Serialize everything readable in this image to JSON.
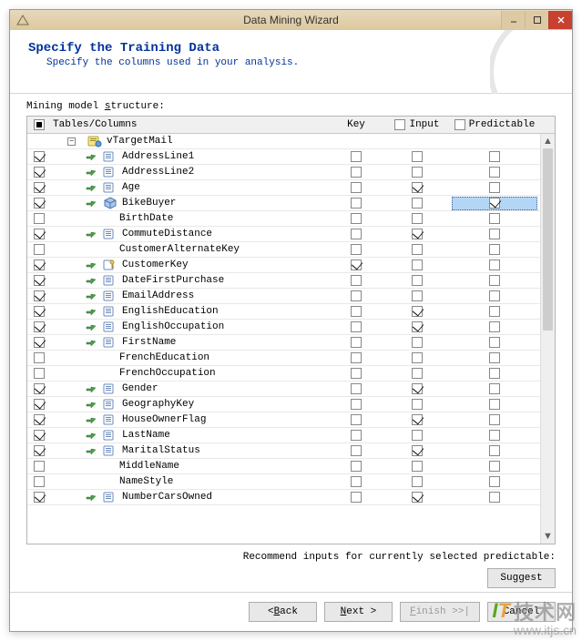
{
  "window": {
    "title": "Data Mining Wizard"
  },
  "header": {
    "title": "Specify the Training Data",
    "subtitle": "Specify the columns used in your analysis."
  },
  "structure_label_pre": "Mining model ",
  "structure_label_u": "s",
  "structure_label_post": "tructure:",
  "table": {
    "head_name": "Tables/Columns",
    "head_key": "Key",
    "head_input": "Input",
    "head_pred": "Predictable",
    "group": "vTargetMail",
    "rows": [
      {
        "sel": true,
        "icons": true,
        "name": "AddressLine1",
        "key": false,
        "in": false,
        "pred": false
      },
      {
        "sel": true,
        "icons": true,
        "name": "AddressLine2",
        "key": false,
        "in": false,
        "pred": false
      },
      {
        "sel": true,
        "icons": true,
        "name": "Age",
        "key": false,
        "in": true,
        "pred": false
      },
      {
        "sel": true,
        "icons": true,
        "name": "BikeBuyer",
        "sel_icon_variant": "cube",
        "key": false,
        "in": false,
        "pred": true,
        "pred_highlight": true
      },
      {
        "sel": false,
        "icons": false,
        "name": "BirthDate",
        "key": false,
        "in": false,
        "pred": false
      },
      {
        "sel": true,
        "icons": true,
        "name": "CommuteDistance",
        "key": false,
        "in": true,
        "pred": false
      },
      {
        "sel": false,
        "icons": false,
        "name": "CustomerAlternateKey",
        "key": false,
        "in": false,
        "pred": false
      },
      {
        "sel": true,
        "icons": true,
        "name": "CustomerKey",
        "sel_icon_variant": "key",
        "key": true,
        "in": false,
        "pred": false
      },
      {
        "sel": true,
        "icons": true,
        "name": "DateFirstPurchase",
        "key": false,
        "in": false,
        "pred": false
      },
      {
        "sel": true,
        "icons": true,
        "name": "EmailAddress",
        "key": false,
        "in": false,
        "pred": false
      },
      {
        "sel": true,
        "icons": true,
        "name": "EnglishEducation",
        "key": false,
        "in": true,
        "pred": false
      },
      {
        "sel": true,
        "icons": true,
        "name": "EnglishOccupation",
        "key": false,
        "in": true,
        "pred": false
      },
      {
        "sel": true,
        "icons": true,
        "name": "FirstName",
        "key": false,
        "in": false,
        "pred": false
      },
      {
        "sel": false,
        "icons": false,
        "name": "FrenchEducation",
        "key": false,
        "in": false,
        "pred": false
      },
      {
        "sel": false,
        "icons": false,
        "name": "FrenchOccupation",
        "key": false,
        "in": false,
        "pred": false
      },
      {
        "sel": true,
        "icons": true,
        "name": "Gender",
        "key": false,
        "in": true,
        "pred": false
      },
      {
        "sel": true,
        "icons": true,
        "name": "GeographyKey",
        "key": false,
        "in": false,
        "pred": false
      },
      {
        "sel": true,
        "icons": true,
        "name": "HouseOwnerFlag",
        "key": false,
        "in": true,
        "pred": false
      },
      {
        "sel": true,
        "icons": true,
        "name": "LastName",
        "key": false,
        "in": false,
        "pred": false
      },
      {
        "sel": true,
        "icons": true,
        "name": "MaritalStatus",
        "key": false,
        "in": true,
        "pred": false
      },
      {
        "sel": false,
        "icons": false,
        "name": "MiddleName",
        "key": false,
        "in": false,
        "pred": false
      },
      {
        "sel": false,
        "icons": false,
        "name": "NameStyle",
        "key": false,
        "in": false,
        "pred": false
      },
      {
        "sel": true,
        "icons": true,
        "name": "NumberCarsOwned",
        "key": false,
        "in": true,
        "pred": false
      }
    ]
  },
  "recommend_label": "Recommend inputs for currently selected predictable:",
  "buttons": {
    "suggest": "Suggest",
    "back": "< Back",
    "next": "Next >",
    "finish": "Finish >>|",
    "cancel": "Cancel"
  },
  "watermark": {
    "text": "技术网",
    "url": "www.itjs.cn"
  }
}
